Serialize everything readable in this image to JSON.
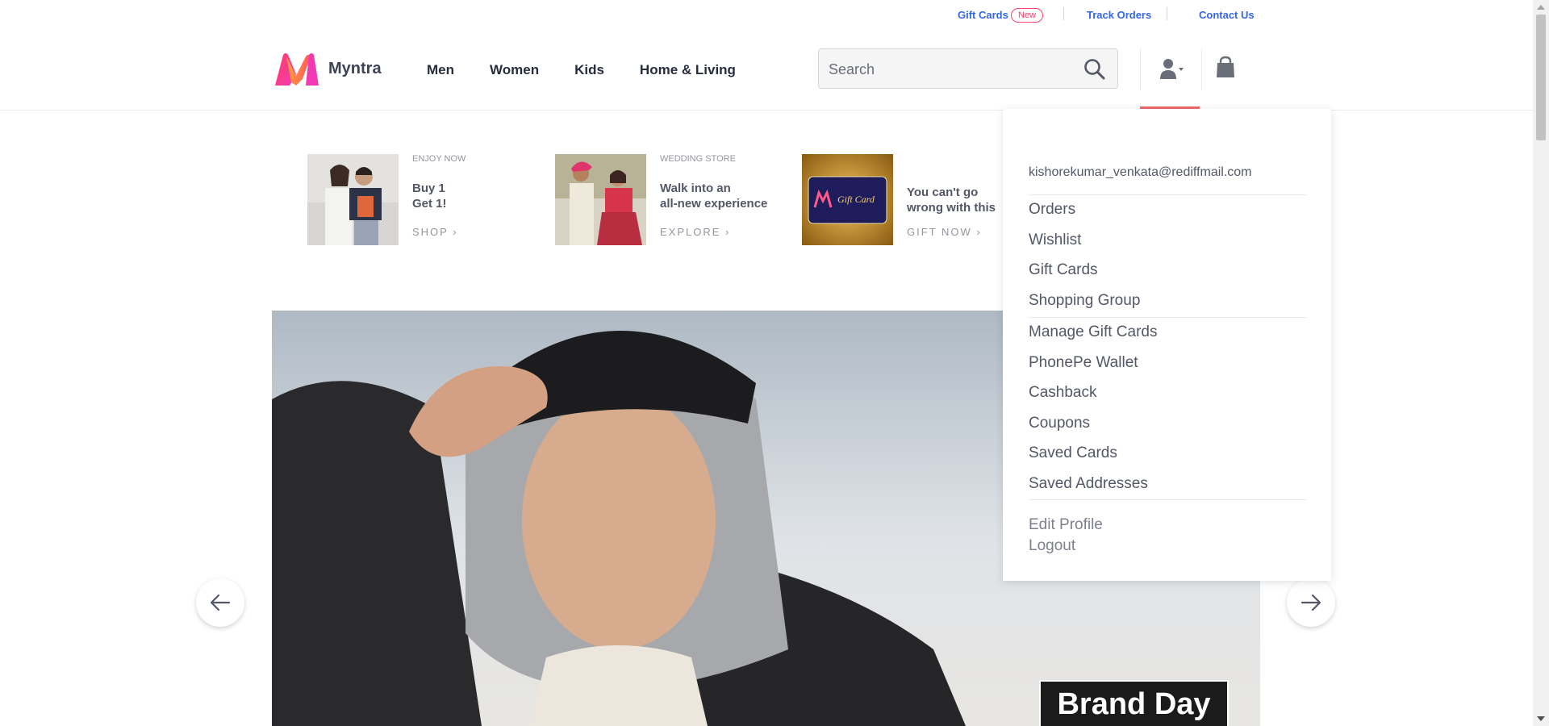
{
  "utility": {
    "gift_cards": "Gift Cards",
    "new_badge": "New",
    "track_orders": "Track Orders",
    "contact_us": "Contact Us"
  },
  "header": {
    "brand": "Myntra",
    "nav": [
      "Men",
      "Women",
      "Kids",
      "Home & Living"
    ],
    "search_placeholder": "Search",
    "icons": [
      "search-icon",
      "profile-icon",
      "bag-icon"
    ]
  },
  "dropdown": {
    "email": "kishorekumar_venkata@rediffmail.com",
    "group1": [
      "Orders",
      "Wishlist",
      "Gift Cards",
      "Shopping Group"
    ],
    "group2": [
      "Manage Gift Cards",
      "PhonePe Wallet",
      "Cashback",
      "Coupons",
      "Saved Cards",
      "Saved Addresses"
    ],
    "group3": [
      "Edit Profile",
      "Logout"
    ]
  },
  "promos": [
    {
      "kicker": "ENJOY NOW",
      "title_line1": "Buy 1",
      "title_line2": "Get 1!",
      "cta": "SHOP"
    },
    {
      "kicker": "WEDDING STORE",
      "title_line1": "Walk into an",
      "title_line2": "all-new experience",
      "cta": "EXPLORE"
    },
    {
      "kicker": "",
      "title_line1": "You can't go",
      "title_line2": "wrong with this",
      "cta": "GIFT NOW",
      "card_text": "Gift Card"
    }
  ],
  "hero": {
    "badge": "Brand Day"
  },
  "colors": {
    "accent": "#ff3f6c",
    "link": "#3466e8",
    "profile_underline": "#f06a6a"
  }
}
